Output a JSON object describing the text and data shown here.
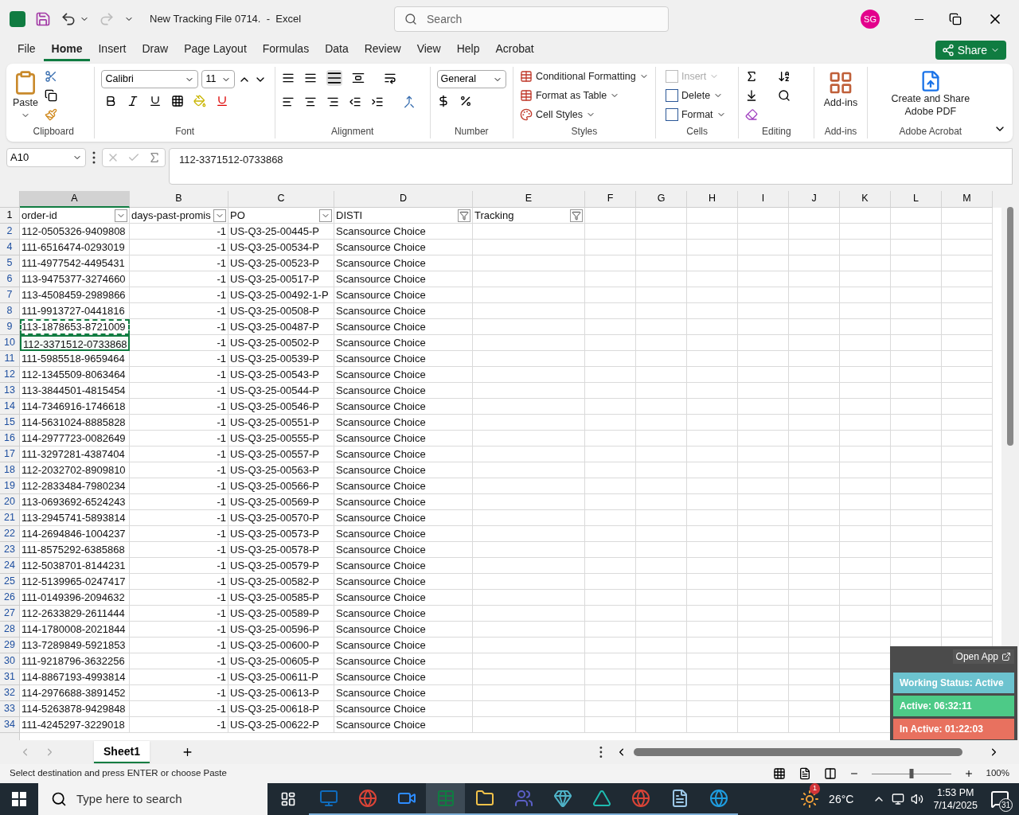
{
  "title_bar": {
    "file_title": "New Tracking File 0714.  -  Excel",
    "search_placeholder": "Search",
    "avatar_initials": "SG"
  },
  "menu_tabs": [
    {
      "label": "File",
      "selected": false
    },
    {
      "label": "Home",
      "selected": true
    },
    {
      "label": "Insert",
      "selected": false
    },
    {
      "label": "Draw",
      "selected": false
    },
    {
      "label": "Page Layout",
      "selected": false
    },
    {
      "label": "Formulas",
      "selected": false
    },
    {
      "label": "Data",
      "selected": false
    },
    {
      "label": "Review",
      "selected": false
    },
    {
      "label": "View",
      "selected": false
    },
    {
      "label": "Help",
      "selected": false
    },
    {
      "label": "Acrobat",
      "selected": false
    }
  ],
  "share_button": "Share",
  "ribbon": {
    "clipboard": {
      "paste": "Paste",
      "label": "Clipboard"
    },
    "font": {
      "font_name": "Calibri",
      "font_size": "11",
      "label": "Font"
    },
    "alignment": {
      "label": "Alignment"
    },
    "number": {
      "format": "General",
      "label": "Number"
    },
    "styles": {
      "items": [
        "Conditional Formatting",
        "Format as Table",
        "Cell Styles"
      ],
      "label": "Styles"
    },
    "cells": {
      "items": [
        {
          "label": "Insert",
          "disabled": true
        },
        {
          "label": "Delete",
          "disabled": false
        },
        {
          "label": "Format",
          "disabled": false
        }
      ],
      "label": "Cells"
    },
    "editing": {
      "label": "Editing"
    },
    "addins": {
      "button": "Add-ins",
      "label": "Add-ins"
    },
    "acrobat": {
      "button_lines": [
        "Create and Share",
        "Adobe PDF"
      ],
      "label": "Adobe Acrobat"
    }
  },
  "formula_bar": {
    "name_box": "A10",
    "value": "112-3371512-0733868"
  },
  "sheet": {
    "columns": [
      {
        "letter": "A",
        "selected": true
      },
      {
        "letter": "B",
        "selected": false
      },
      {
        "letter": "C",
        "selected": false
      },
      {
        "letter": "D",
        "selected": false
      },
      {
        "letter": "E",
        "selected": false
      },
      {
        "letter": "F",
        "selected": false
      },
      {
        "letter": "G",
        "selected": false
      },
      {
        "letter": "H",
        "selected": false
      },
      {
        "letter": "I",
        "selected": false
      },
      {
        "letter": "J",
        "selected": false
      },
      {
        "letter": "K",
        "selected": false
      },
      {
        "letter": "L",
        "selected": false
      },
      {
        "letter": "M",
        "selected": false
      }
    ],
    "header_row": {
      "number": "1",
      "headers": [
        {
          "text": "order-id",
          "filter_applied": false
        },
        {
          "text": "days-past-promis",
          "filter_applied": false
        },
        {
          "text": "PO",
          "filter_applied": false
        },
        {
          "text": "DISTI",
          "filter_applied": true
        },
        {
          "text": "Tracking",
          "filter_applied": true
        }
      ]
    },
    "rows": [
      {
        "number": "2",
        "selected": false,
        "copied": false,
        "cells": [
          "112-0505326-9409808",
          "-1",
          "US-Q3-25-00445-P",
          "Scansource Choice"
        ]
      },
      {
        "number": "4",
        "selected": false,
        "copied": false,
        "cells": [
          "111-6516474-0293019",
          "-1",
          "US-Q3-25-00534-P",
          "Scansource Choice"
        ]
      },
      {
        "number": "5",
        "selected": false,
        "copied": false,
        "cells": [
          "111-4977542-4495431",
          "-1",
          "US-Q3-25-00523-P",
          "Scansource Choice"
        ]
      },
      {
        "number": "6",
        "selected": false,
        "copied": false,
        "cells": [
          "113-9475377-3274660",
          "-1",
          "US-Q3-25-00517-P",
          "Scansource Choice"
        ]
      },
      {
        "number": "7",
        "selected": false,
        "copied": false,
        "cells": [
          "113-4508459-2989866",
          "-1",
          "US-Q3-25-00492-1-P",
          "Scansource Choice"
        ]
      },
      {
        "number": "8",
        "selected": false,
        "copied": false,
        "cells": [
          "111-9913727-0441816",
          "-1",
          "US-Q3-25-00508-P",
          "Scansource Choice"
        ]
      },
      {
        "number": "9",
        "selected": false,
        "copied": true,
        "cells": [
          "113-1878653-8721009",
          "-1",
          "US-Q3-25-00487-P",
          "Scansource Choice"
        ]
      },
      {
        "number": "10",
        "selected": true,
        "copied": false,
        "cells": [
          "112-3371512-0733868",
          "-1",
          "US-Q3-25-00502-P",
          "Scansource Choice"
        ]
      },
      {
        "number": "11",
        "selected": false,
        "copied": false,
        "cells": [
          "111-5985518-9659464",
          "-1",
          "US-Q3-25-00539-P",
          "Scansource Choice"
        ]
      },
      {
        "number": "12",
        "selected": false,
        "copied": false,
        "cells": [
          "112-1345509-8063464",
          "-1",
          "US-Q3-25-00543-P",
          "Scansource Choice"
        ]
      },
      {
        "number": "13",
        "selected": false,
        "copied": false,
        "cells": [
          "113-3844501-4815454",
          "-1",
          "US-Q3-25-00544-P",
          "Scansource Choice"
        ]
      },
      {
        "number": "14",
        "selected": false,
        "copied": false,
        "cells": [
          "114-7346916-1746618",
          "-1",
          "US-Q3-25-00546-P",
          "Scansource Choice"
        ]
      },
      {
        "number": "15",
        "selected": false,
        "copied": false,
        "cells": [
          "114-5631024-8885828",
          "-1",
          "US-Q3-25-00551-P",
          "Scansource Choice"
        ]
      },
      {
        "number": "16",
        "selected": false,
        "copied": false,
        "cells": [
          "114-2977723-0082649",
          "-1",
          "US-Q3-25-00555-P",
          "Scansource Choice"
        ]
      },
      {
        "number": "17",
        "selected": false,
        "copied": false,
        "cells": [
          "111-3297281-4387404",
          "-1",
          "US-Q3-25-00557-P",
          "Scansource Choice"
        ]
      },
      {
        "number": "18",
        "selected": false,
        "copied": false,
        "cells": [
          "112-2032702-8909810",
          "-1",
          "US-Q3-25-00563-P",
          "Scansource Choice"
        ]
      },
      {
        "number": "19",
        "selected": false,
        "copied": false,
        "cells": [
          "112-2833484-7980234",
          "-1",
          "US-Q3-25-00566-P",
          "Scansource Choice"
        ]
      },
      {
        "number": "20",
        "selected": false,
        "copied": false,
        "cells": [
          "113-0693692-6524243",
          "-1",
          "US-Q3-25-00569-P",
          "Scansource Choice"
        ]
      },
      {
        "number": "21",
        "selected": false,
        "copied": false,
        "cells": [
          "113-2945741-5893814",
          "-1",
          "US-Q3-25-00570-P",
          "Scansource Choice"
        ]
      },
      {
        "number": "22",
        "selected": false,
        "copied": false,
        "cells": [
          "114-2694846-1004237",
          "-1",
          "US-Q3-25-00573-P",
          "Scansource Choice"
        ]
      },
      {
        "number": "23",
        "selected": false,
        "copied": false,
        "cells": [
          "111-8575292-6385868",
          "-1",
          "US-Q3-25-00578-P",
          "Scansource Choice"
        ]
      },
      {
        "number": "24",
        "selected": false,
        "copied": false,
        "cells": [
          "112-5038701-8144231",
          "-1",
          "US-Q3-25-00579-P",
          "Scansource Choice"
        ]
      },
      {
        "number": "25",
        "selected": false,
        "copied": false,
        "cells": [
          "112-5139965-0247417",
          "-1",
          "US-Q3-25-00582-P",
          "Scansource Choice"
        ]
      },
      {
        "number": "26",
        "selected": false,
        "copied": false,
        "cells": [
          "111-0149396-2094632",
          "-1",
          "US-Q3-25-00585-P",
          "Scansource Choice"
        ]
      },
      {
        "number": "27",
        "selected": false,
        "copied": false,
        "cells": [
          "112-2633829-2611444",
          "-1",
          "US-Q3-25-00589-P",
          "Scansource Choice"
        ]
      },
      {
        "number": "28",
        "selected": false,
        "copied": false,
        "cells": [
          "114-1780008-2021844",
          "-1",
          "US-Q3-25-00596-P",
          "Scansource Choice"
        ]
      },
      {
        "number": "29",
        "selected": false,
        "copied": false,
        "cells": [
          "113-7289849-5921853",
          "-1",
          "US-Q3-25-00600-P",
          "Scansource Choice"
        ]
      },
      {
        "number": "30",
        "selected": false,
        "copied": false,
        "cells": [
          "111-9218796-3632256",
          "-1",
          "US-Q3-25-00605-P",
          "Scansource Choice"
        ]
      },
      {
        "number": "31",
        "selected": false,
        "copied": false,
        "cells": [
          "114-8867193-4993814",
          "-1",
          "US-Q3-25-00611-P",
          "Scansource Choice"
        ]
      },
      {
        "number": "32",
        "selected": false,
        "copied": false,
        "cells": [
          "114-2976688-3891452",
          "-1",
          "US-Q3-25-00613-P",
          "Scansource Choice"
        ]
      },
      {
        "number": "33",
        "selected": false,
        "copied": false,
        "cells": [
          "114-5263878-9429848",
          "-1",
          "US-Q3-25-00618-P",
          "Scansource Choice"
        ]
      },
      {
        "number": "34",
        "selected": false,
        "copied": false,
        "cells": [
          "111-4245297-3229018",
          "-1",
          "US-Q3-25-00622-P",
          "Scansource Choice"
        ]
      }
    ]
  },
  "sheet_tabs": [
    {
      "label": "Sheet1",
      "selected": true
    }
  ],
  "status_bar": {
    "message": "Select destination and press ENTER or choose Paste",
    "zoom": "100%",
    "zoom_slider": {
      "level": 0.5
    }
  },
  "tracker_widget": {
    "open_button": "Open App",
    "lines": [
      {
        "text": "Working Status: Active",
        "color": "#6cc3cf"
      },
      {
        "text": "Active: 06:32:11",
        "color": "#4dca87"
      },
      {
        "text": "In Active: 01:22:03",
        "color": "#e8715f"
      }
    ]
  },
  "taskbar": {
    "search_placeholder": "Type here to search",
    "apps": [
      {
        "kind": "outlook",
        "selected": false
      },
      {
        "kind": "chrome",
        "selected": false
      },
      {
        "kind": "zoom",
        "selected": false
      },
      {
        "kind": "excel",
        "selected": true
      },
      {
        "kind": "folder",
        "selected": false
      },
      {
        "kind": "teams",
        "selected": false
      },
      {
        "kind": "gem",
        "selected": false
      },
      {
        "kind": "surfshark",
        "selected": false
      },
      {
        "kind": "chrome",
        "selected": false
      },
      {
        "kind": "notepad",
        "selected": false
      },
      {
        "kind": "edge",
        "selected": false
      }
    ],
    "weather_badge": "1",
    "temperature": "26°C",
    "time": "1:53 PM",
    "date": "7/14/2025",
    "notifications": "31"
  }
}
